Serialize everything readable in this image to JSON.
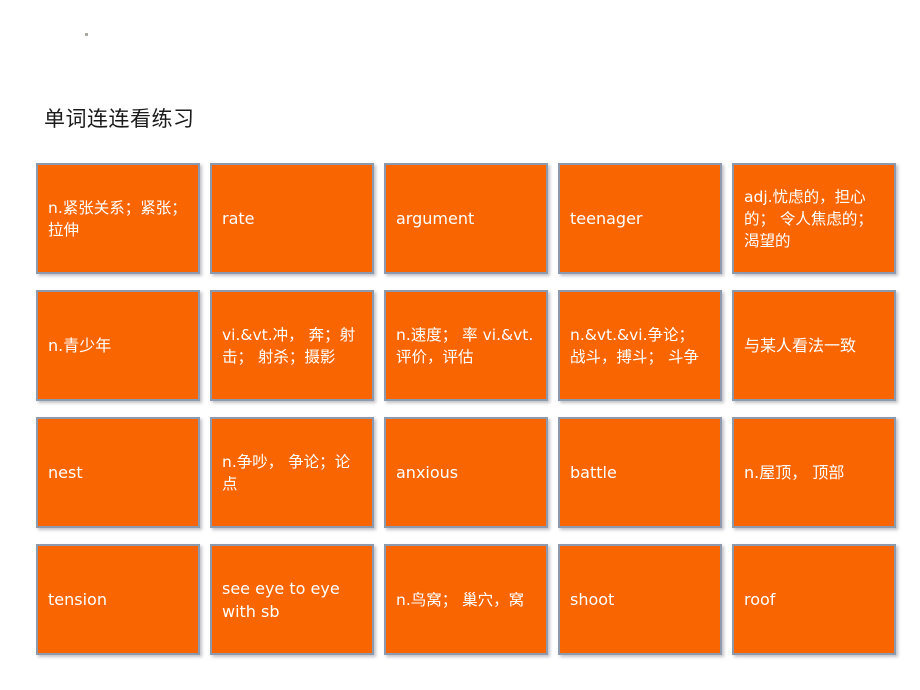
{
  "slide": {
    "title": "单词连连看练习",
    "stray_mark": "·",
    "card_color": "#F96500",
    "card_border_color": "#8D9AAD",
    "card_text_color": "#FFFFFF",
    "background_color": "#FFFFFF"
  },
  "grid": {
    "columns": 5,
    "rows": 4,
    "cards": [
      {
        "id": "card-r1c1",
        "text": "n.紧张关系；紧张； 拉伸",
        "dense": true
      },
      {
        "id": "card-r1c2",
        "text": "rate",
        "dense": false
      },
      {
        "id": "card-r1c3",
        "text": "argument",
        "dense": false
      },
      {
        "id": "card-r1c4",
        "text": "teenager",
        "dense": false
      },
      {
        "id": "card-r1c5",
        "text": "adj.忧虑的，担心的； 令人焦虑的； 渴望的",
        "dense": true
      },
      {
        "id": "card-r2c1",
        "text": "n.青少年",
        "dense": false
      },
      {
        "id": "card-r2c2",
        "text": "vi.&vt.冲， 奔；射击； 射杀；摄影",
        "dense": true
      },
      {
        "id": "card-r2c3",
        "text": "n.速度； 率 vi.&vt.评价，评估",
        "dense": true
      },
      {
        "id": "card-r2c4",
        "text": "n.&vt.&vi.争论； 战斗，搏斗； 斗争",
        "dense": true
      },
      {
        "id": "card-r2c5",
        "text": "与某人看法一致",
        "dense": false
      },
      {
        "id": "card-r3c1",
        "text": "nest",
        "dense": false
      },
      {
        "id": "card-r3c2",
        "text": "n.争吵， 争论；论点",
        "dense": true
      },
      {
        "id": "card-r3c3",
        "text": "anxious",
        "dense": false
      },
      {
        "id": "card-r3c4",
        "text": "battle",
        "dense": false
      },
      {
        "id": "card-r3c5",
        "text": "n.屋顶， 顶部",
        "dense": false
      },
      {
        "id": "card-r4c1",
        "text": "tension",
        "dense": false
      },
      {
        "id": "card-r4c2",
        "text": "see eye to eye with sb",
        "dense": false
      },
      {
        "id": "card-r4c3",
        "text": "n.鸟窝； 巢穴，窝",
        "dense": true
      },
      {
        "id": "card-r4c4",
        "text": "shoot",
        "dense": false
      },
      {
        "id": "card-r4c5",
        "text": "roof",
        "dense": false
      }
    ]
  }
}
